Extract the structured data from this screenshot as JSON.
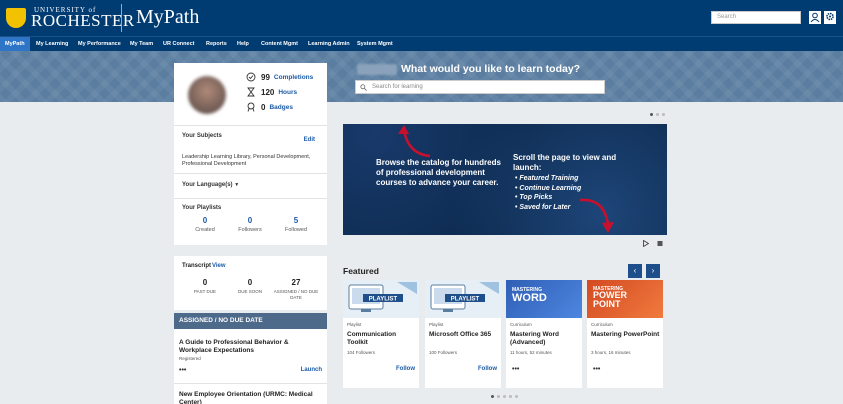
{
  "header": {
    "logo_top": "UNIVERSITY of",
    "logo_main": "ROCHESTER",
    "app_name": "MyPath",
    "search_placeholder": "Search"
  },
  "nav": {
    "items": [
      "MyPath",
      "My Learning",
      "My Performance",
      "My Team",
      "UR Connect",
      "Reports",
      "Help",
      "Content Mgmt",
      "Learning Admin",
      "System Mgmt"
    ],
    "active": "MyPath"
  },
  "hero": {
    "title": "What would you like to learn today?",
    "search_placeholder": "Search for learning"
  },
  "profile": {
    "completions_count": "99",
    "completions_label": "Completions",
    "hours_count": "120",
    "hours_label": "Hours",
    "badges_count": "0",
    "badges_label": "Badges",
    "subjects_label": "Your Subjects",
    "edit_label": "Edit",
    "subjects_text": "Leadership Learning Library, Personal Development, Professional Development",
    "languages_label": "Your Language(s)",
    "playlists_label": "Your Playlists",
    "playlists": [
      {
        "num": "0",
        "label": "Created"
      },
      {
        "num": "0",
        "label": "Followers"
      },
      {
        "num": "5",
        "label": "Followed"
      }
    ]
  },
  "transcript": {
    "title": "Transcript",
    "view_label": "View",
    "cols": [
      {
        "num": "0",
        "label": "PAST DUE"
      },
      {
        "num": "0",
        "label": "DUE SOON"
      },
      {
        "num": "27",
        "label": "ASSIGNED / NO DUE DATE"
      }
    ]
  },
  "assigned": {
    "header": "ASSIGNED / NO DUE DATE",
    "items": [
      {
        "title": "A Guide to Professional Behavior & Workplace Expectations",
        "status": "Registered",
        "more": "•••",
        "action": "Launch"
      },
      {
        "title": "New Employee Orientation (URMC: Medical Center)"
      }
    ]
  },
  "banner": {
    "left_text": "Browse the catalog for hundreds of professional development courses to advance your career.",
    "right_title": "Scroll the page to view and launch:",
    "list": [
      "Featured Training",
      "Continue Learning",
      "Top Picks",
      "Saved for Later"
    ]
  },
  "featured": {
    "title": "Featured",
    "prev": "‹",
    "next": "›",
    "cards": [
      {
        "thumb": "playlist",
        "thumb_text": "PLAYLIST",
        "type": "Playlist",
        "title": "Communication Toolkit",
        "meta": "104 Followers",
        "more": "",
        "action": "Follow"
      },
      {
        "thumb": "playlist",
        "thumb_text": "PLAYLIST",
        "type": "Playlist",
        "title": "Microsoft Office 365",
        "meta": "100 Followers",
        "more": "",
        "action": "Follow"
      },
      {
        "thumb": "word",
        "thumb_text_small": "MASTERING",
        "thumb_text": "WORD",
        "type": "Curriculum",
        "title": "Mastering Word (Advanced)",
        "meta": "11 hours, 52 minutes",
        "more": "•••",
        "action": ""
      },
      {
        "thumb": "ppt",
        "thumb_text_small": "MASTERING",
        "thumb_text": "POWER POINT",
        "type": "Curriculum",
        "title": "Mastering PowerPoint",
        "meta": "3 hours, 16 minutes",
        "more": "•••",
        "action": ""
      }
    ]
  },
  "colors": {
    "header_bg": "#003b71",
    "nav_active": "#2e75c7",
    "link": "#1a5aa6",
    "assigned_header": "#4d6a8a",
    "banner_bg": "#0d2a4e"
  },
  "icons": [
    "user-icon",
    "gear-icon",
    "checkmark-circle-icon",
    "hourglass-icon",
    "badge-icon",
    "search-icon",
    "play-icon",
    "pause-icon"
  ]
}
